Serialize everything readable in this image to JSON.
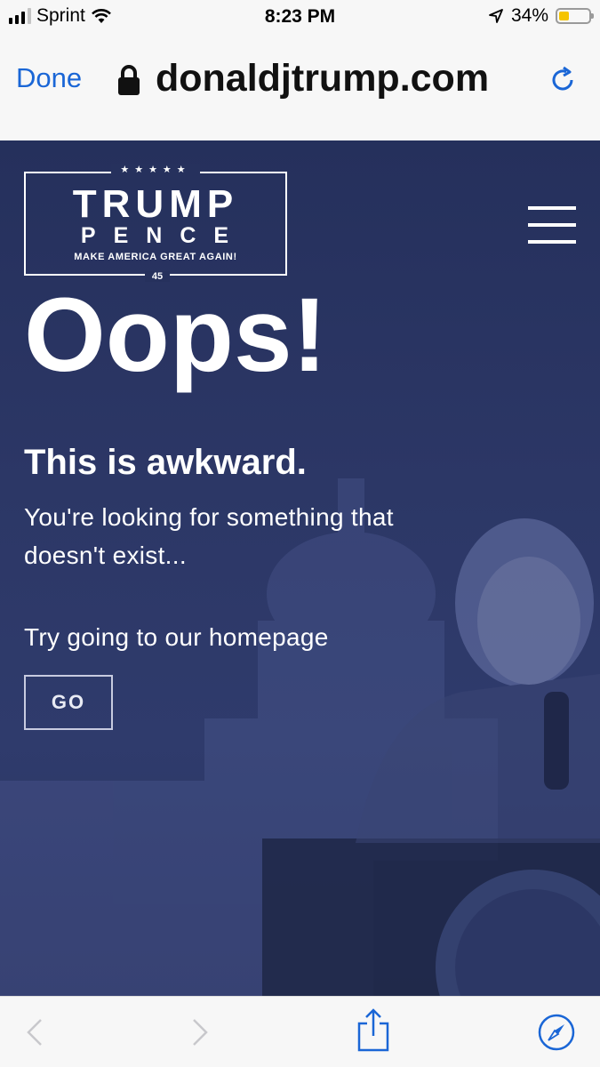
{
  "status_bar": {
    "carrier": "Sprint",
    "time": "8:23 PM",
    "battery_percent": "34%",
    "battery_level": 0.34,
    "signal_bars_filled": 3,
    "signal_bars_total": 4,
    "icons": [
      "signal-icon",
      "wifi-icon",
      "location-arrow-icon",
      "battery-icon"
    ]
  },
  "url_bar": {
    "done_label": "Done",
    "domain": "donaldjtrump.com",
    "lock_icon": "lock-icon",
    "reload_icon": "reload-icon"
  },
  "page": {
    "logo": {
      "stars": "★★★★★",
      "line1": "TRUMP",
      "line2": "PENCE",
      "tagline": "MAKE AMERICA GREAT AGAIN!",
      "number": "45"
    },
    "menu_icon": "hamburger-menu-icon",
    "heading": "Oops!",
    "subheading": "This is awkward.",
    "message": "You're looking for something that doesn't exist...",
    "prompt": "Try going to our homepage",
    "go_label": "GO"
  },
  "toolbar": {
    "icons": [
      "back-icon",
      "forward-icon",
      "share-icon",
      "safari-compass-icon"
    ]
  },
  "colors": {
    "accent": "#1a66d6",
    "page_bg": "#2c3766",
    "battery_fill": "#f5c400"
  }
}
